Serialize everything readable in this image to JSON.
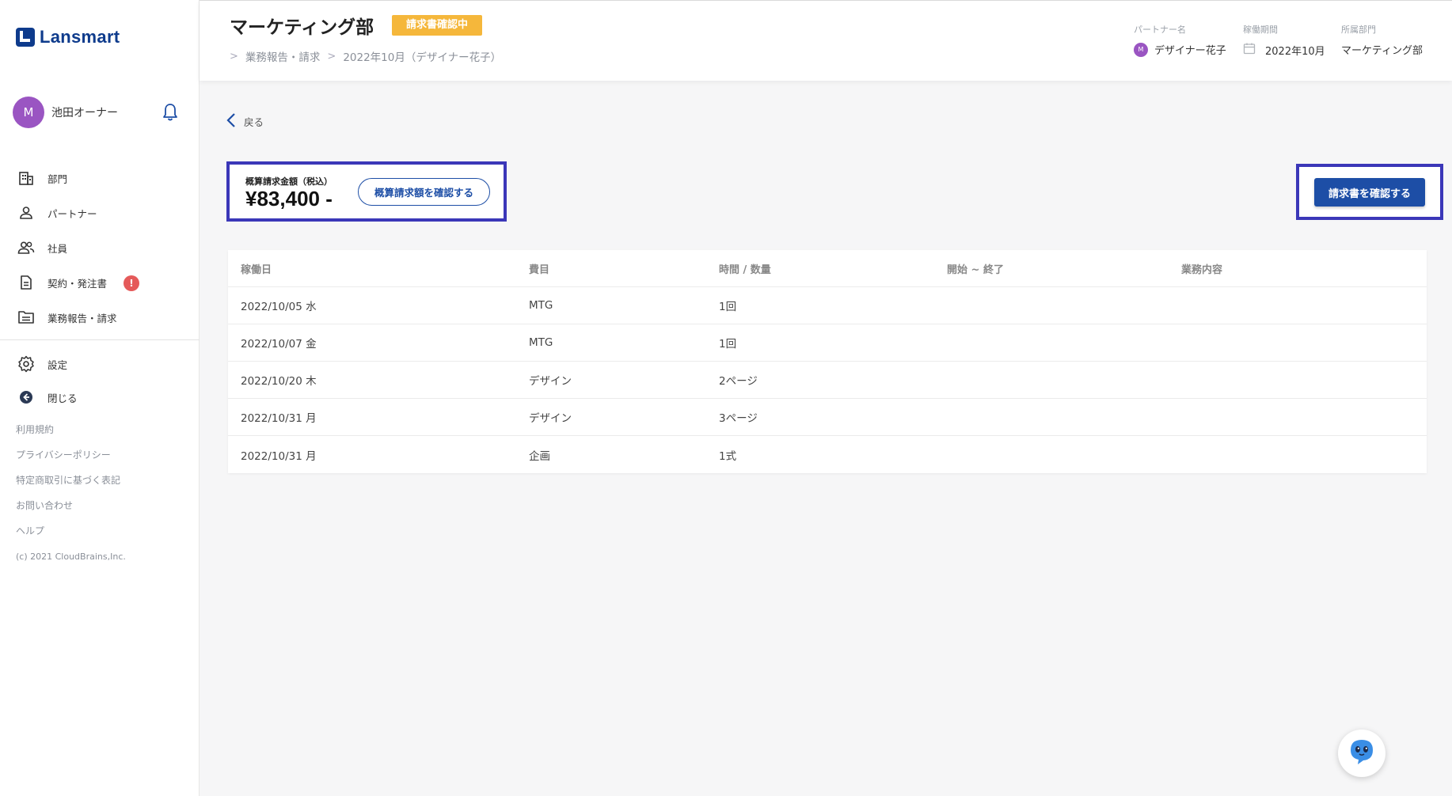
{
  "app": {
    "logo_text": "Lansmart"
  },
  "user": {
    "avatar_initial": "M",
    "name": "池田オーナー"
  },
  "nav": {
    "items": [
      {
        "label": "部門",
        "icon": "building-icon"
      },
      {
        "label": "パートナー",
        "icon": "person-icon"
      },
      {
        "label": "社員",
        "icon": "people-icon"
      },
      {
        "label": "契約・発注書",
        "icon": "document-icon",
        "badge": "!"
      },
      {
        "label": "業務報告・請求",
        "icon": "folder-icon"
      }
    ],
    "secondary": [
      {
        "label": "設定",
        "icon": "gear-icon"
      },
      {
        "label": "閉じる",
        "icon": "collapse-icon"
      }
    ],
    "footer_links": [
      "利用規約",
      "プライバシーポリシー",
      "特定商取引に基づく表記",
      "お問い合わせ",
      "ヘルプ"
    ],
    "copyright": "(c) 2021 CloudBrains,Inc."
  },
  "header": {
    "title": "マーケティング部",
    "status": "請求書確認中",
    "breadcrumb": [
      "業務報告・請求",
      "2022年10月（デザイナー花子）"
    ],
    "partner_label": "パートナー名",
    "partner_initial": "M",
    "partner_value": "デザイナー花子",
    "period_label": "稼働期間",
    "period_value": "2022年10月",
    "dept_label": "所属部門",
    "dept_value": "マーケティング部"
  },
  "main": {
    "back_label": "戻る",
    "amount_label": "概算請求金額（税込）",
    "amount_value": "¥83,400 -",
    "check_amount_button": "概算請求額を確認する",
    "confirm_invoice_button": "請求書を確認する"
  },
  "table": {
    "columns": [
      "稼働日",
      "費目",
      "時間 / 数量",
      "開始 ~ 終了",
      "業務内容"
    ],
    "rows": [
      [
        "2022/10/05 水",
        "MTG",
        "1回",
        "",
        ""
      ],
      [
        "2022/10/07 金",
        "MTG",
        "1回",
        "",
        ""
      ],
      [
        "2022/10/20 木",
        "デザイン",
        "2ページ",
        "",
        ""
      ],
      [
        "2022/10/31 月",
        "デザイン",
        "3ページ",
        "",
        ""
      ],
      [
        "2022/10/31 月",
        "企画",
        "1式",
        "",
        ""
      ]
    ]
  },
  "colors": {
    "brand": "#0e3b8c",
    "primary": "#1d4ea6",
    "status": "#f5b73b",
    "badge": "#e55a5a",
    "avatar": "#9a55c2",
    "highlight": "#3b37b8"
  }
}
